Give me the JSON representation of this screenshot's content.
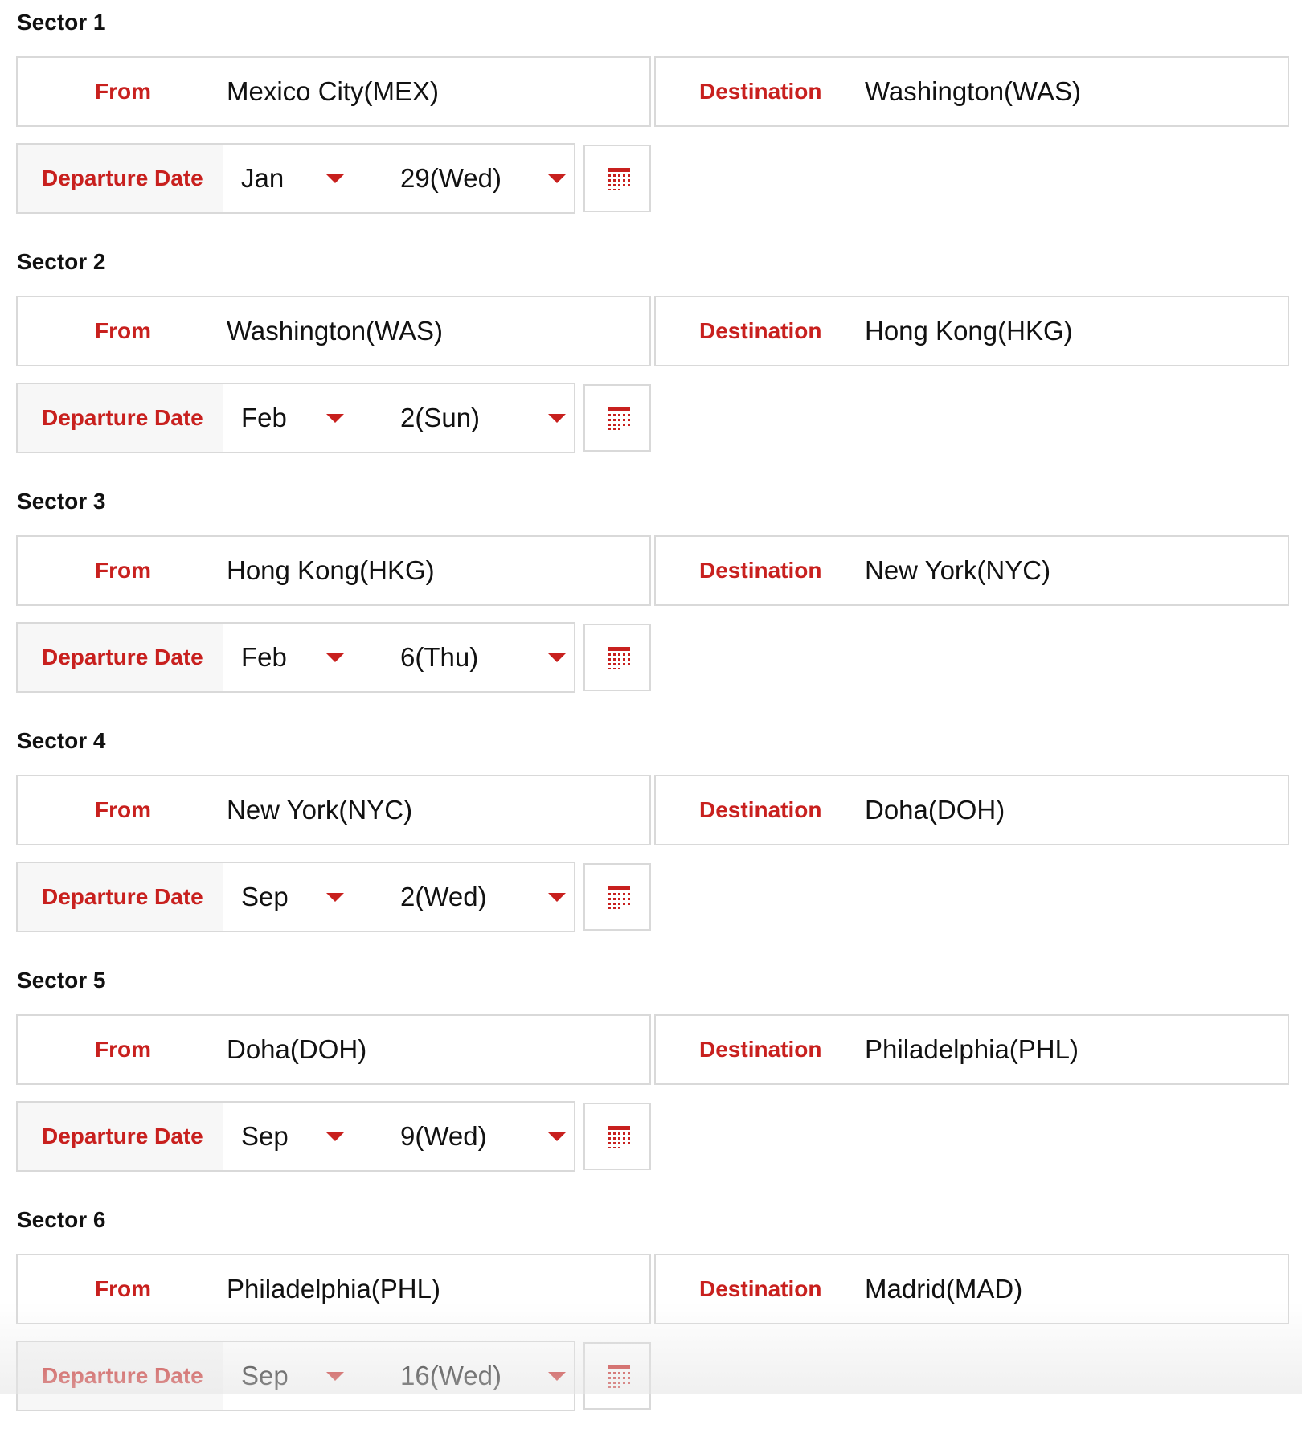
{
  "labels": {
    "from": "From",
    "destination": "Destination",
    "departure_date": "Departure Date"
  },
  "colors": {
    "accent": "#c8201e",
    "border": "#d9d9d9",
    "label_bg": "#f7f7f7"
  },
  "icons": {
    "dropdown": "caret-down-icon",
    "calendar": "calendar-icon"
  },
  "sectors": [
    {
      "title": "Sector 1",
      "from": "Mexico City(MEX)",
      "destination": "Washington(WAS)",
      "month": "Jan",
      "day": "29(Wed)"
    },
    {
      "title": "Sector 2",
      "from": "Washington(WAS)",
      "destination": "Hong Kong(HKG)",
      "month": "Feb",
      "day": "2(Sun)"
    },
    {
      "title": "Sector 3",
      "from": "Hong Kong(HKG)",
      "destination": "New York(NYC)",
      "month": "Feb",
      "day": "6(Thu)"
    },
    {
      "title": "Sector 4",
      "from": "New York(NYC)",
      "destination": "Doha(DOH)",
      "month": "Sep",
      "day": "2(Wed)"
    },
    {
      "title": "Sector 5",
      "from": "Doha(DOH)",
      "destination": "Philadelphia(PHL)",
      "month": "Sep",
      "day": "9(Wed)"
    },
    {
      "title": "Sector 6",
      "from": "Philadelphia(PHL)",
      "destination": "Madrid(MAD)",
      "month": "Sep",
      "day": "16(Wed)"
    }
  ]
}
